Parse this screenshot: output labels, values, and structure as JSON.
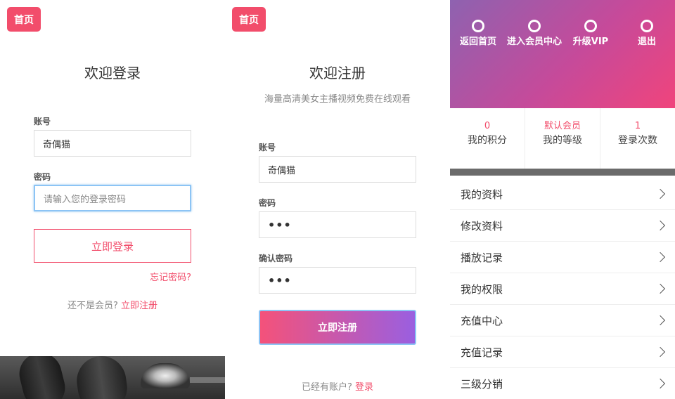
{
  "login": {
    "home_label": "首页",
    "title": "欢迎登录",
    "account_label": "账号",
    "account_value": "奇偶猫",
    "password_label": "密码",
    "password_placeholder": "请输入您的登录密码",
    "login_button": "立即登录",
    "forgot_link": "忘记密码?",
    "not_member_text": "还不是会员?",
    "register_link": "立即注册"
  },
  "register": {
    "home_label": "首页",
    "title": "欢迎注册",
    "subtitle": "海量高清美女主播视频免费在线观看",
    "account_label": "账号",
    "account_value": "奇偶猫",
    "password_label": "密码",
    "password_value": "•••",
    "confirm_label": "确认密码",
    "confirm_value": "•••",
    "register_button": "立即注册",
    "have_account_text": "已经有账户?",
    "login_link": "登录"
  },
  "member": {
    "nav": [
      {
        "label": "返回首页"
      },
      {
        "label": "进入会员中心"
      },
      {
        "label": "升级VIP"
      },
      {
        "label": "退出"
      }
    ],
    "stats": [
      {
        "value": "0",
        "label": "我的积分"
      },
      {
        "value": "默认会员",
        "label": "我的等级"
      },
      {
        "value": "1",
        "label": "登录次数"
      }
    ],
    "menu": [
      {
        "label": "我的资料"
      },
      {
        "label": "修改资料"
      },
      {
        "label": "播放记录"
      },
      {
        "label": "我的权限"
      },
      {
        "label": "充值中心"
      },
      {
        "label": "充值记录"
      },
      {
        "label": "三级分销"
      }
    ]
  },
  "colors": {
    "accent": "#f24d6b",
    "gradient_start": "#f4527a",
    "gradient_end": "#9a5fe0"
  }
}
